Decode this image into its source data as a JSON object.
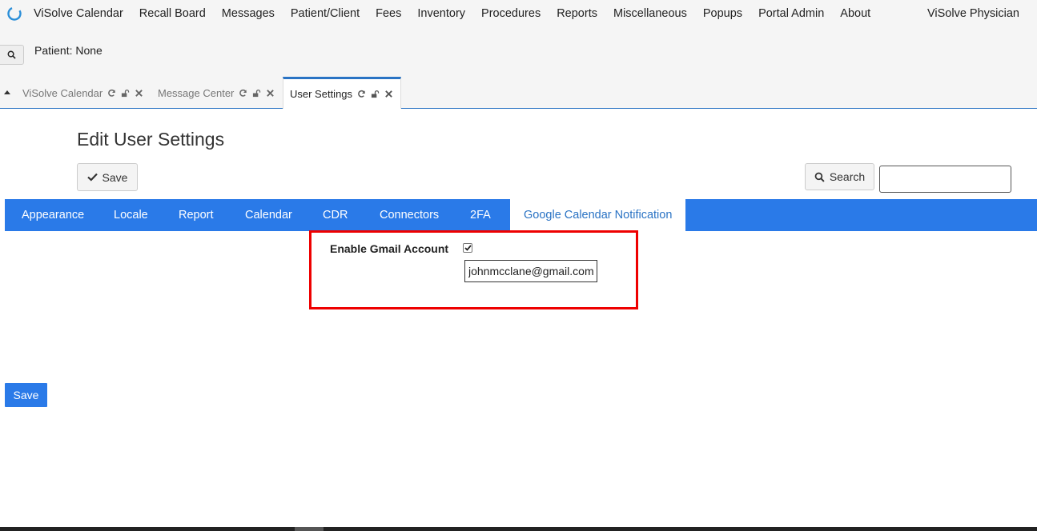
{
  "nav": {
    "items": [
      "ViSolve Calendar",
      "Recall Board",
      "Messages",
      "Patient/Client",
      "Fees",
      "Inventory",
      "Procedures",
      "Reports",
      "Miscellaneous",
      "Popups",
      "Portal Admin",
      "About"
    ],
    "user": "ViSolve Physician"
  },
  "patient": {
    "label": "Patient: None"
  },
  "tabs": [
    {
      "label": "ViSolve Calendar"
    },
    {
      "label": "Message Center"
    },
    {
      "label": "User Settings"
    }
  ],
  "page": {
    "title": "Edit User Settings",
    "save_label": "Save",
    "search_label": "Search",
    "search_value": ""
  },
  "settings_tabs": [
    "Appearance",
    "Locale",
    "Report",
    "Calendar",
    "CDR",
    "Connectors",
    "2FA",
    "Google Calendar Notification"
  ],
  "gmail": {
    "label": "Enable Gmail Account",
    "checked": true,
    "email": "johnmcclane@gmail.com"
  },
  "footer": {
    "save_label": "Save"
  },
  "colors": {
    "accent": "#2a7ae8",
    "highlight": "#e00000"
  }
}
